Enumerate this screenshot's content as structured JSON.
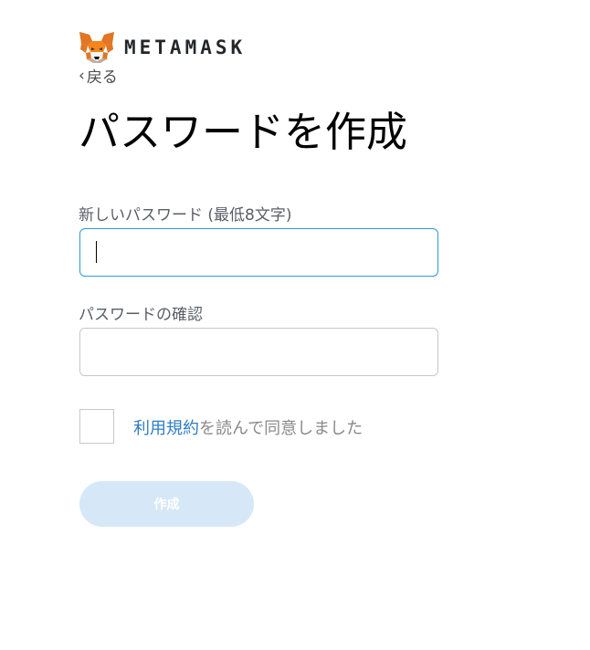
{
  "brand": {
    "wordmark": "METAMASK",
    "logo_icon": "metamask-fox-icon",
    "accent_color": "#f6851b"
  },
  "nav": {
    "back_label": "戻る",
    "back_icon": "chevron-left-icon"
  },
  "page": {
    "title": "パスワードを作成"
  },
  "form": {
    "new_password_label": "新しいパスワード (最低8文字)",
    "new_password_value": "",
    "confirm_password_label": "パスワードの確認",
    "confirm_password_value": "",
    "terms_checked": false,
    "terms_link_text": "利用規約",
    "terms_rest_text": "を読んで同意しました",
    "create_button_label": "作成",
    "create_button_enabled": false,
    "focus_color": "#3098dc",
    "link_color": "#2f7dc4",
    "button_disabled_color": "#d6e8f8"
  }
}
